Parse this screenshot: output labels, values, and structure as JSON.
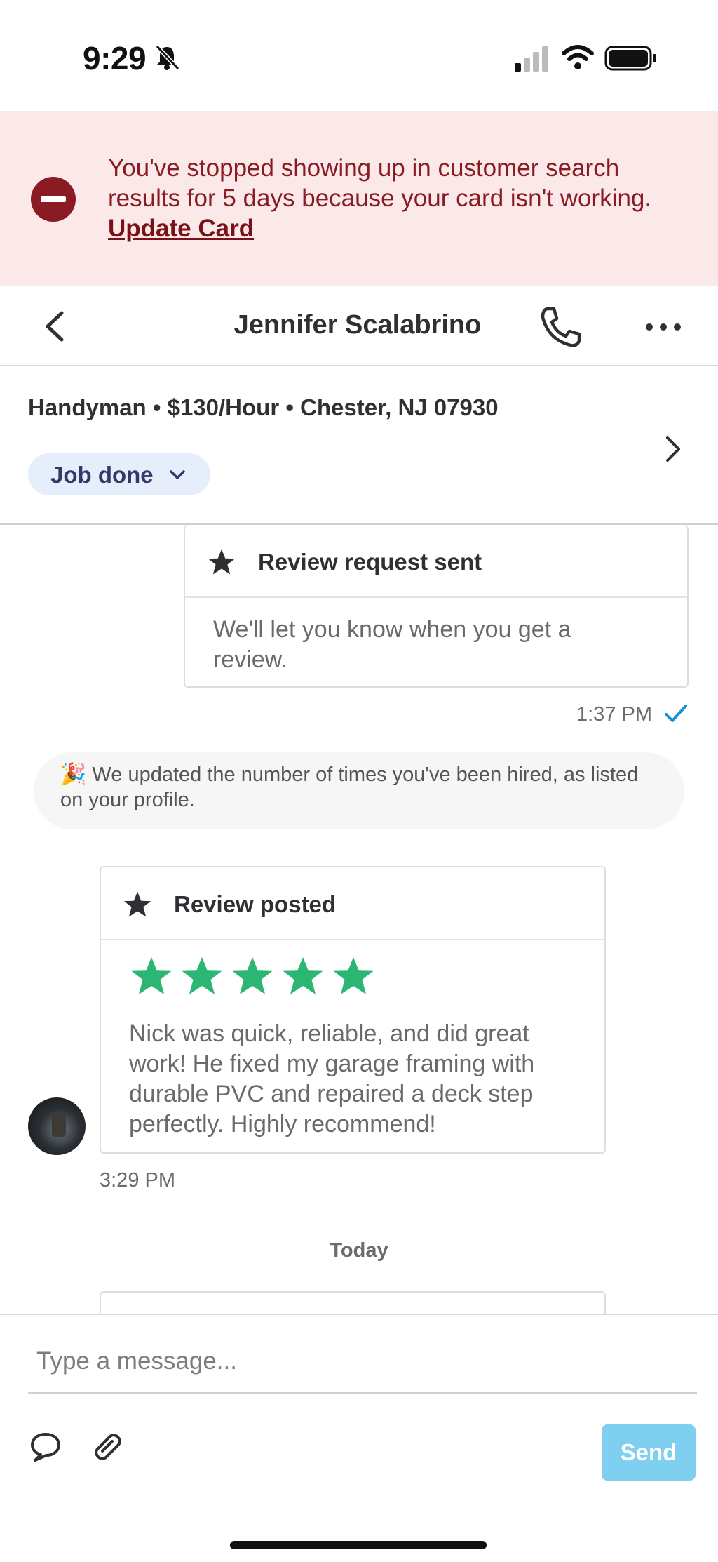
{
  "status_bar": {
    "time": "9:29",
    "icons": [
      "bell-off-icon",
      "signal-icon",
      "wifi-icon",
      "battery-icon"
    ]
  },
  "alert": {
    "message": "You've stopped showing up in customer search results for 5 days because your card isn't working.",
    "link_label": "Update Card",
    "color": "#8a1b22",
    "background": "#fbe9e9"
  },
  "header": {
    "title": "Jennifer Scalabrino",
    "icons": [
      "back-icon",
      "phone-icon",
      "more-icon"
    ]
  },
  "job": {
    "details": "Handyman • $130/Hour • Chester, NJ 07930",
    "status_label": "Job done"
  },
  "messages": {
    "review_request": {
      "title": "Review request sent",
      "body": "We'll let you know when you get a review.",
      "time": "1:37 PM"
    },
    "system_notice": {
      "emoji": "🎉",
      "text": "We updated the number of times you've been hired, as listed on your profile."
    },
    "review_posted": {
      "title": "Review posted",
      "rating": 5,
      "rating_max": 5,
      "star_color": "#2bb673",
      "body": "Nick was quick, reliable, and did great work! He fixed my garage framing with durable PVC and repaired a deck step perfectly. Highly recommend!",
      "time": "3:29 PM"
    },
    "day_separator": "Today"
  },
  "composer": {
    "placeholder": "Type a message...",
    "send_label": "Send",
    "send_color": "#7fd0f0",
    "icons": [
      "chat-bubble-icon",
      "paperclip-icon"
    ]
  }
}
